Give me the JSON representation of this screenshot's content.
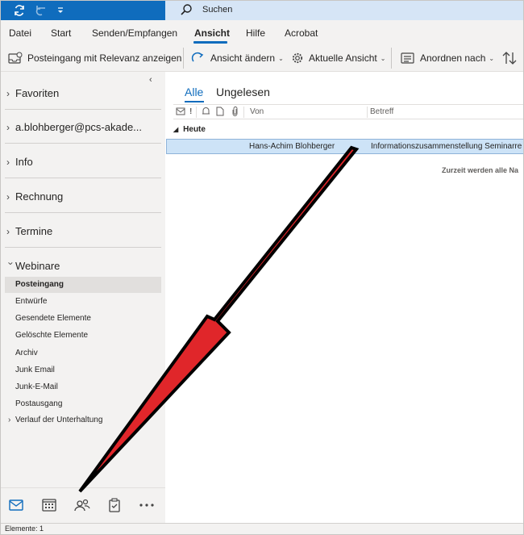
{
  "title_bar": {
    "search_placeholder": "Suchen",
    "accent": "#0f6cbd",
    "icons": [
      "sync-icon",
      "undo-icon",
      "customize-dropdown-icon",
      "search-icon"
    ]
  },
  "menu": {
    "tabs": [
      "Datei",
      "Start",
      "Senden/Empfangen",
      "Ansicht",
      "Hilfe",
      "Acrobat"
    ],
    "active_tab": "Ansicht"
  },
  "ribbon": {
    "focused_inbox": "Posteingang mit Relevanz anzeigen",
    "change_view": "Ansicht ändern",
    "current_view": "Aktuelle Ansicht",
    "arrange_by": "Anordnen nach",
    "sort_icon": "sort-icon"
  },
  "folder_pane": {
    "groups": {
      "favorites": "Favoriten",
      "account": "a.blohberger@pcs-akade...",
      "info": "Info",
      "invoice": "Rechnung",
      "appointments": "Termine",
      "webinars": "Webinare"
    },
    "webinar_folders": [
      "Posteingang",
      "Entwürfe",
      "Gesendete Elemente",
      "Gelöschte Elemente",
      "Archiv",
      "Junk Email",
      "Junk-E-Mail",
      "Postausgang",
      "Verlauf der Unterhaltung"
    ],
    "selected_folder": "Posteingang"
  },
  "nav_bar": {
    "icons": [
      "mail-icon",
      "calendar-icon",
      "people-icon",
      "tasks-icon",
      "more-icon"
    ]
  },
  "message_list": {
    "filters": [
      "Alle",
      "Ungelesen"
    ],
    "active_filter": "Alle",
    "columns": {
      "from": "Von",
      "subject": "Betreff"
    },
    "group_header": "Heute",
    "messages": [
      {
        "from": "Hans-Achim Blohberger",
        "subject": "Informationszusammenstellung Seminarre"
      }
    ],
    "notice": "Zurzeit werden alle Na"
  },
  "status_bar": {
    "text": "Elemente: 1"
  },
  "annotation": {
    "arrow_color": "#e0262a",
    "outline_color": "#000000"
  }
}
